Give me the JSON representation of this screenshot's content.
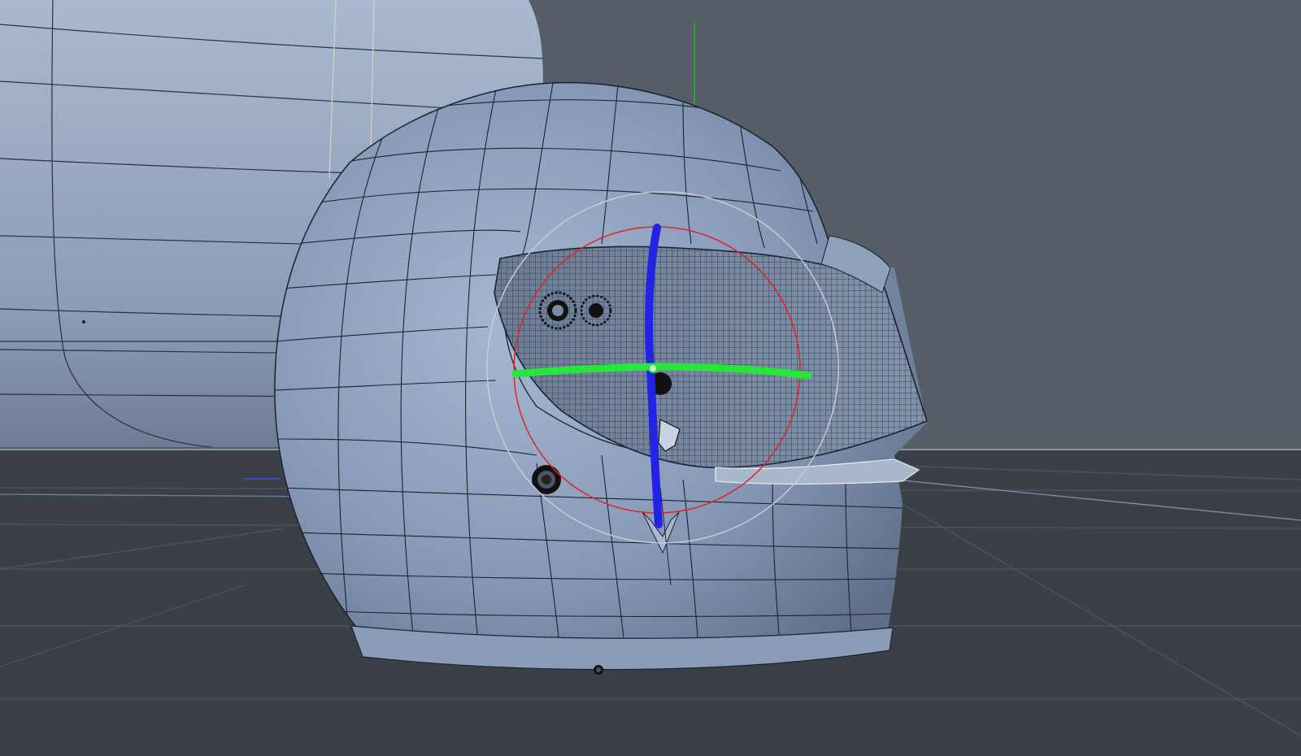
{
  "viewport": {
    "background_color": "#555d66",
    "floor_color": "#3b4047",
    "model_color": "#8899b4",
    "wire_color": "#1b2230"
  },
  "gizmo": {
    "rotate_ring_color": "#e02424",
    "trackball_ring_color": "#c8ccd2",
    "axis_vertical_color": "#2323e6",
    "axis_horizontal_color": "#27e63a",
    "up_axis_color": "#28b02f"
  }
}
